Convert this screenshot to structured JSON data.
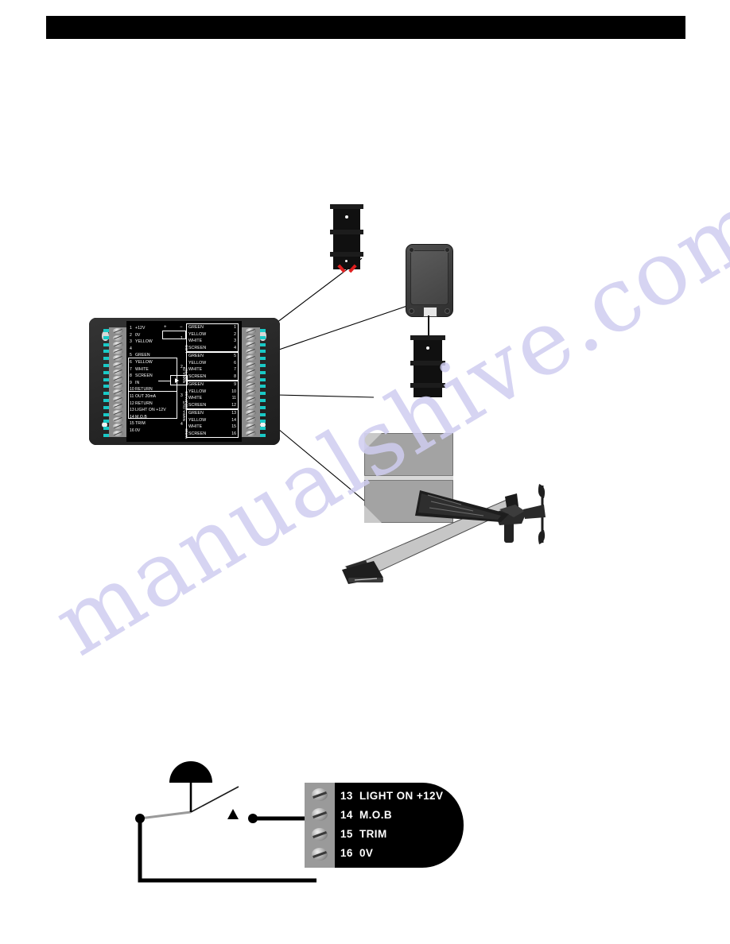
{
  "header": {
    "bar_label": ""
  },
  "watermark": {
    "text": "manualshive.com",
    "color": "#cfcdf0"
  },
  "main_diagram": {
    "instrument_unit": {
      "name": "instrument-junction-unit",
      "battery": {
        "plus": "+",
        "minus": "−"
      },
      "left_terminals": [
        {
          "num": "1",
          "label": "+12V"
        },
        {
          "num": "2",
          "label": "0V"
        },
        {
          "num": "3",
          "label": "YELLOW"
        },
        {
          "num": "4",
          "label": ""
        },
        {
          "num": "5",
          "label": "GREEN"
        },
        {
          "num": "6",
          "label": "YELLOW"
        },
        {
          "num": "7",
          "label": "WHITE"
        },
        {
          "num": "8",
          "label": "SCREEN"
        },
        {
          "num": "9",
          "label": "IN"
        },
        {
          "num": "10",
          "label": "RETURN"
        },
        {
          "num": "11",
          "label": "OUT 20mA"
        },
        {
          "num": "12",
          "label": "RETURN"
        },
        {
          "num": "13",
          "label": "LIGHT ON +12V"
        },
        {
          "num": "14",
          "label": "M.O.B"
        },
        {
          "num": "15",
          "label": "TRIM"
        },
        {
          "num": "16",
          "label": "0V"
        }
      ],
      "vertical_labels": [
        "NMEA IN",
        "NMEA OUT"
      ],
      "sensor_groups": [
        {
          "index": "1",
          "tag": "LOG",
          "rows": [
            {
              "wire": "GREEN",
              "num": "1"
            },
            {
              "wire": "YELLOW",
              "num": "2"
            },
            {
              "wire": "WHITE",
              "num": "3"
            },
            {
              "wire": "SCREEN",
              "num": "4"
            }
          ]
        },
        {
          "index": "2",
          "tag": "DEPTH",
          "rows": [
            {
              "wire": "GREEN",
              "num": "5"
            },
            {
              "wire": "YELLOW",
              "num": "6"
            },
            {
              "wire": "WHITE",
              "num": "7"
            },
            {
              "wire": "SCREEN",
              "num": "8"
            }
          ]
        },
        {
          "index": "3",
          "tag": "COMPASS",
          "rows": [
            {
              "wire": "GREEN",
              "num": "9"
            },
            {
              "wire": "YELLOW",
              "num": "10"
            },
            {
              "wire": "WHITE",
              "num": "11"
            },
            {
              "wire": "SCREEN",
              "num": "12"
            }
          ]
        },
        {
          "index": "4",
          "tag": "WIND",
          "rows": [
            {
              "wire": "GREEN",
              "num": "13"
            },
            {
              "wire": "YELLOW",
              "num": "14"
            },
            {
              "wire": "WHITE",
              "num": "15"
            },
            {
              "wire": "SCREEN",
              "num": "16"
            }
          ]
        }
      ]
    },
    "components": [
      {
        "name": "log-transducer",
        "note": ""
      },
      {
        "name": "display-module",
        "note": ""
      },
      {
        "name": "depth-transducer",
        "note": ""
      },
      {
        "name": "hull-block",
        "note": ""
      },
      {
        "name": "masthead-wind-unit",
        "note": ""
      }
    ]
  },
  "lower_diagram": {
    "terminals": [
      {
        "num": "13",
        "label": "LIGHT ON +12V"
      },
      {
        "num": "14",
        "label": "M.O.B"
      },
      {
        "num": "15",
        "label": "TRIM"
      },
      {
        "num": "16",
        "label": "0V"
      }
    ],
    "switch_name": "push-button-switch"
  }
}
